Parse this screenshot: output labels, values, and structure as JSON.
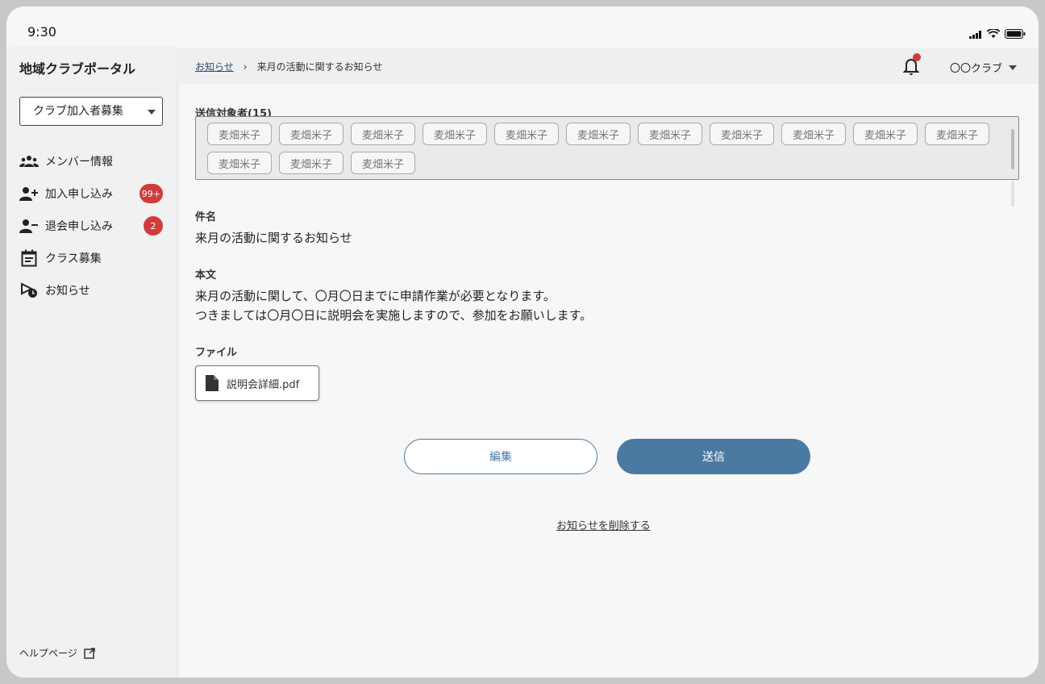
{
  "status": {
    "time": "9:30"
  },
  "sidebar": {
    "app_title": "地域クラブポータル",
    "selected_club_mode": "クラブ加入者募集",
    "items": [
      {
        "label": "メンバー情報",
        "icon": "members-icon"
      },
      {
        "label": "加入申し込み",
        "icon": "person-add-icon",
        "badge": "99+"
      },
      {
        "label": "退会申し込み",
        "icon": "person-remove-icon",
        "badge": "2"
      },
      {
        "label": "クラス募集",
        "icon": "calendar-icon"
      },
      {
        "label": "お知らせ",
        "icon": "notice-icon"
      }
    ],
    "help_label": "ヘルプページ"
  },
  "header": {
    "breadcrumb_parent": "お知らせ",
    "breadcrumb_separator": "›",
    "breadcrumb_current": "来月の活動に関するお知らせ",
    "club_name": "〇〇クラブ"
  },
  "main": {
    "recipients_label": "送信対象者(15)",
    "recipients": [
      "麦畑米子",
      "麦畑米子",
      "麦畑米子",
      "麦畑米子",
      "麦畑米子",
      "麦畑米子",
      "麦畑米子",
      "麦畑米子",
      "麦畑米子",
      "麦畑米子",
      "麦畑米子",
      "麦畑米子",
      "麦畑米子",
      "麦畑米子"
    ],
    "subject_label": "件名",
    "subject": "来月の活動に関するお知らせ",
    "body_label": "本文",
    "body_line1": "来月の活動に関して、〇月〇日までに申請作業が必要となります。",
    "body_line2": "つきましては〇月〇日に説明会を実施しますので、参加をお願いします。",
    "file_label": "ファイル",
    "file_name": "説明会詳細.pdf",
    "edit_button": "編集",
    "send_button": "送信",
    "delete_link": "お知らせを削除する"
  },
  "colors": {
    "accent": "#4a7aa1",
    "badge": "#d13b3b"
  }
}
